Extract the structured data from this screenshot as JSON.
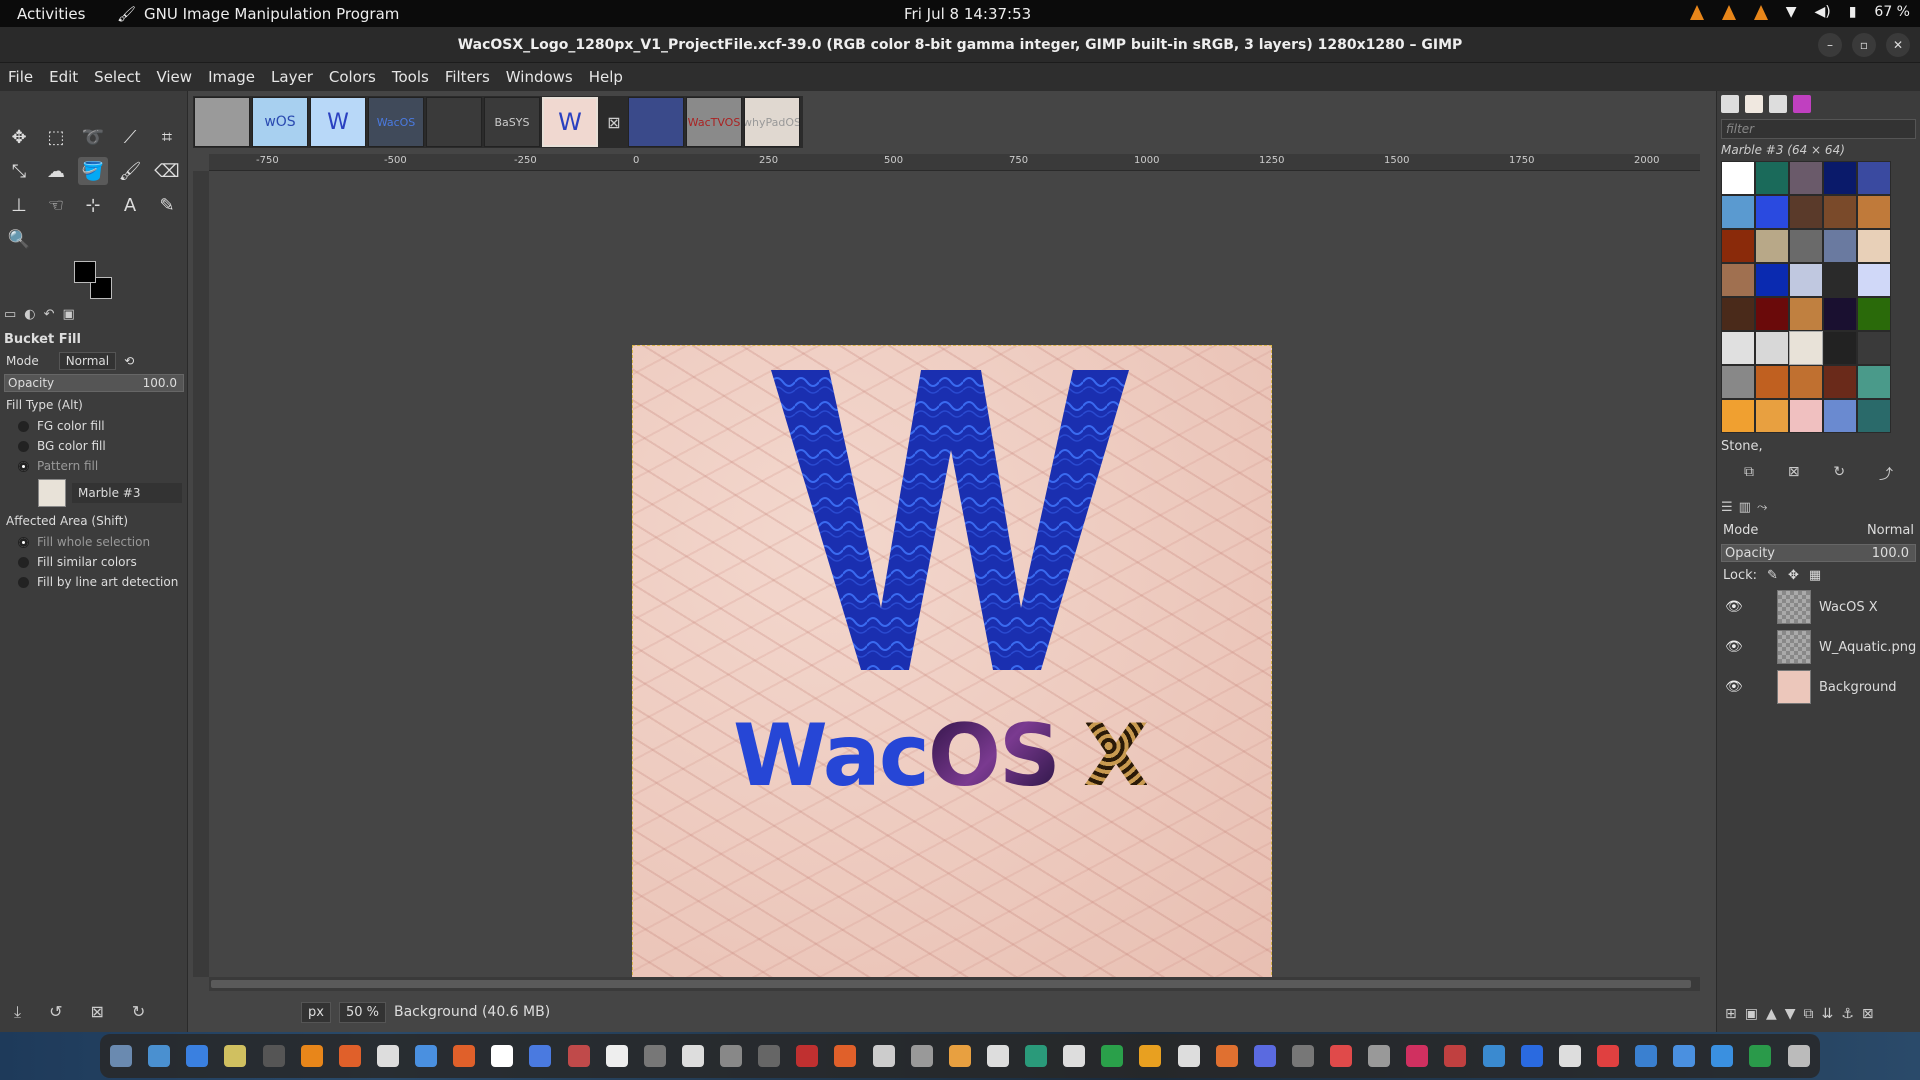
{
  "topbar": {
    "activities": "Activities",
    "app_name": "GNU Image Manipulation Program",
    "clock": "Fri Jul 8  14:37:53",
    "battery": "67 %"
  },
  "window": {
    "title": "WacOSX_Logo_1280px_V1_ProjectFile.xcf-39.0 (RGB color 8-bit gamma integer, GIMP built-in sRGB, 3 layers) 1280x1280 – GIMP"
  },
  "menu": [
    "File",
    "Edit",
    "Select",
    "View",
    "Image",
    "Layer",
    "Colors",
    "Tools",
    "Filters",
    "Windows",
    "Help"
  ],
  "tool_options": {
    "title": "Bucket Fill",
    "mode_label": "Mode",
    "mode_value": "Normal",
    "opacity_label": "Opacity",
    "opacity_value": "100.0",
    "fill_type_label": "Fill Type  (Alt)",
    "fill_types": [
      "FG color fill",
      "BG color fill",
      "Pattern fill"
    ],
    "pattern_name": "Marble #3",
    "affected_area_label": "Affected Area  (Shift)",
    "affected_areas": [
      "Fill whole selection",
      "Fill similar colors",
      "Fill by line art detection"
    ]
  },
  "image_tabs": [
    "",
    "wOS",
    "W",
    "WacOS",
    "",
    "BaSYS",
    "W",
    "",
    "WacTVOS",
    "whyPadOS"
  ],
  "ruler_labels": [
    "-750",
    "-500",
    "-250",
    "0",
    "250",
    "500",
    "750",
    "1000",
    "1250",
    "1500",
    "1750",
    "2000"
  ],
  "logo": {
    "big_letter": "W",
    "word_part1": "Wac",
    "word_part2": "OS",
    "word_part3": "X"
  },
  "statusbar": {
    "unit": "px",
    "zoom": "50 %",
    "layer_info": "Background (40.6 MB)"
  },
  "patterns_panel": {
    "filter_placeholder": "filter",
    "selected_pattern": "Marble #3 (64 × 64)",
    "tag": "Stone,"
  },
  "layers_panel": {
    "mode_label": "Mode",
    "mode_value": "Normal",
    "opacity_label": "Opacity",
    "opacity_value": "100.0",
    "lock_label": "Lock:",
    "layers": [
      "WacOS X",
      "W_Aquatic.png",
      "Background"
    ]
  },
  "colors": {
    "accent_blue": "#2646d6",
    "big_w_blue": "#1a2fb0",
    "canvas_pink": "#ecc7bb",
    "selection_marching": "#d8b64a"
  }
}
